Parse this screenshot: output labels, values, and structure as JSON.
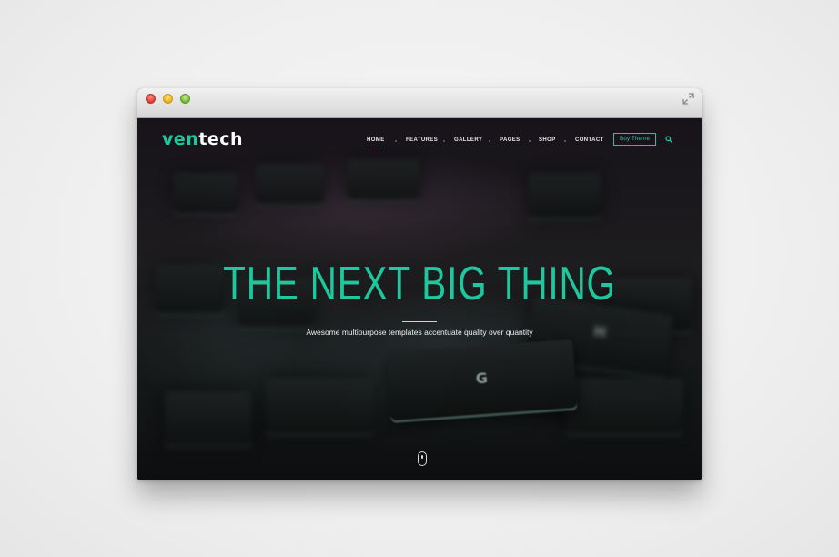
{
  "brand": {
    "logo_part_1": "ven",
    "logo_part_2": "tech",
    "accent_color": "#1fc79e"
  },
  "window": {
    "controls": [
      "close",
      "minimize",
      "zoom"
    ],
    "fullscreen_icon": "expand-arrows-icon"
  },
  "nav": {
    "items": [
      "HOME",
      "FEATURES",
      "GALLERY",
      "PAGES",
      "SHOP",
      "CONTACT"
    ],
    "active": "HOME",
    "cta_label": "Buy Theme",
    "search_icon": "search-icon"
  },
  "hero": {
    "title": "THE NEXT BIG THING",
    "subtitle": "Awesome multipurpose templates accentuate quality over quantity",
    "key_letters": [
      "G",
      "H"
    ],
    "scroll_icon": "mouse-scroll-icon"
  }
}
